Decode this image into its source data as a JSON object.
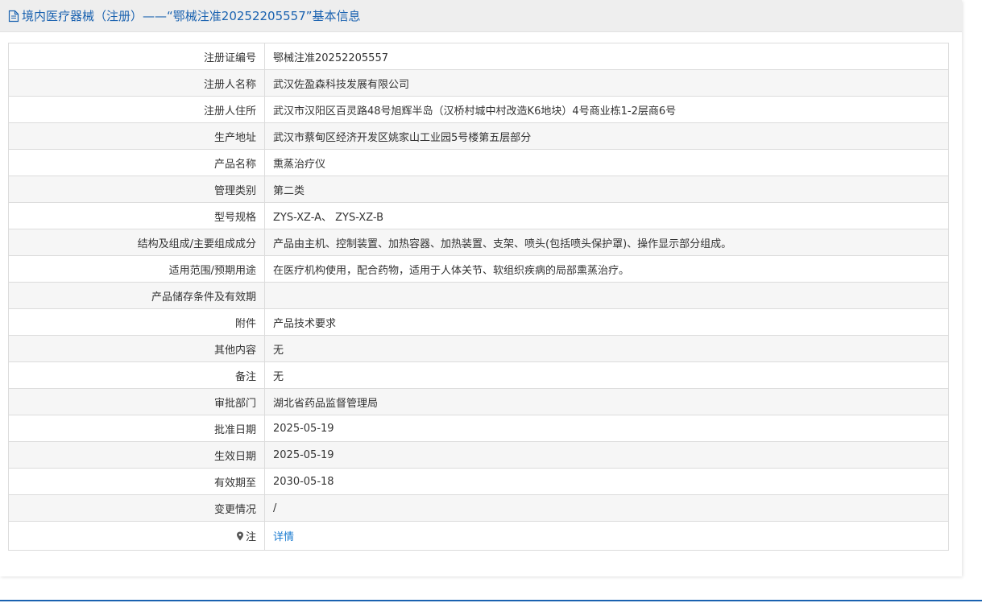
{
  "header": {
    "title": "境内医疗器械（注册）——“鄂械注准20252205557”基本信息",
    "icon": "document-icon"
  },
  "rows": [
    {
      "label": "注册证编号",
      "value": "鄂械注准20252205557"
    },
    {
      "label": "注册人名称",
      "value": "武汉佐盈森科技发展有限公司"
    },
    {
      "label": "注册人住所",
      "value": "武汉市汉阳区百灵路48号旭辉半岛（汉桥村城中村改造K6地块）4号商业栋1-2层商6号"
    },
    {
      "label": "生产地址",
      "value": "武汉市蔡甸区经济开发区姚家山工业园5号楼第五层部分"
    },
    {
      "label": "产品名称",
      "value": "熏蒸治疗仪"
    },
    {
      "label": "管理类别",
      "value": "第二类"
    },
    {
      "label": "型号规格",
      "value": "ZYS-XZ-A、 ZYS-XZ-B"
    },
    {
      "label": "结构及组成/主要组成成分",
      "value": "产品由主机、控制装置、加热容器、加热装置、支架、喷头(包括喷头保护罩)、操作显示部分组成。"
    },
    {
      "label": "适用范围/预期用途",
      "value": "在医疗机构使用，配合药物，适用于人体关节、软组织疾病的局部熏蒸治疗。"
    },
    {
      "label": "产品储存条件及有效期",
      "value": ""
    },
    {
      "label": "附件",
      "value": "产品技术要求"
    },
    {
      "label": "其他内容",
      "value": "无"
    },
    {
      "label": "备注",
      "value": "无"
    },
    {
      "label": "审批部门",
      "value": "湖北省药品监督管理局"
    },
    {
      "label": "批准日期",
      "value": "2025-05-19"
    },
    {
      "label": "生效日期",
      "value": "2025-05-19"
    },
    {
      "label": "有效期至",
      "value": "2030-05-18"
    },
    {
      "label": "变更情况",
      "value": "/"
    }
  ],
  "note_row": {
    "label": "注",
    "icon": "pin-icon",
    "link": "详情"
  },
  "colors": {
    "accent": "#1a62b0",
    "link": "#1a7bd0",
    "header_bg": "#eeeeee",
    "stripe": "#f6f6f6",
    "border": "#dcdcdc"
  }
}
